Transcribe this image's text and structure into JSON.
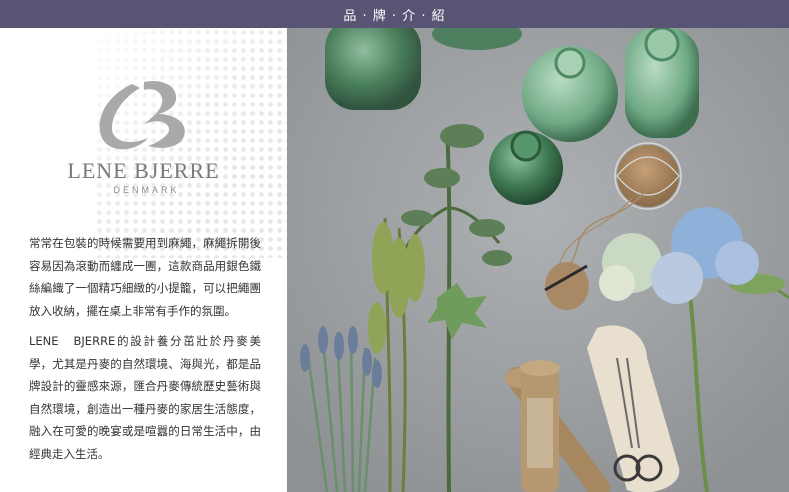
{
  "header": {
    "title": "品 · 牌 · 介 · 紹"
  },
  "brand": {
    "name": "LENE BJERRE",
    "sub": "DENMARK"
  },
  "description": {
    "para1": "常常在包裝的時候需要用到麻繩，麻繩拆開後容易因為滾動而纏成一團，這款商品用銀色鐵絲編織了一個精巧細緻的小提籠，可以把繩團放入收納，擺在桌上非常有手作的氛圍。",
    "para2": "LENE　BJERRE的設計養分茁壯於丹麥美學，尤其是丹麥的自然環境、海與光，都是品牌設計的靈感來源，匯合丹麥傳統歷史藝術與自然環境，創造出一種丹麥的家居生活態度，融入在可愛的晚宴或是喧囂的日常生活中，由經典走入生活。"
  },
  "colors": {
    "topbar": "#585474",
    "logo": "#a9a9a9",
    "bottle_green": "#3f7a52",
    "hydrangea": "#8fb0d8"
  }
}
